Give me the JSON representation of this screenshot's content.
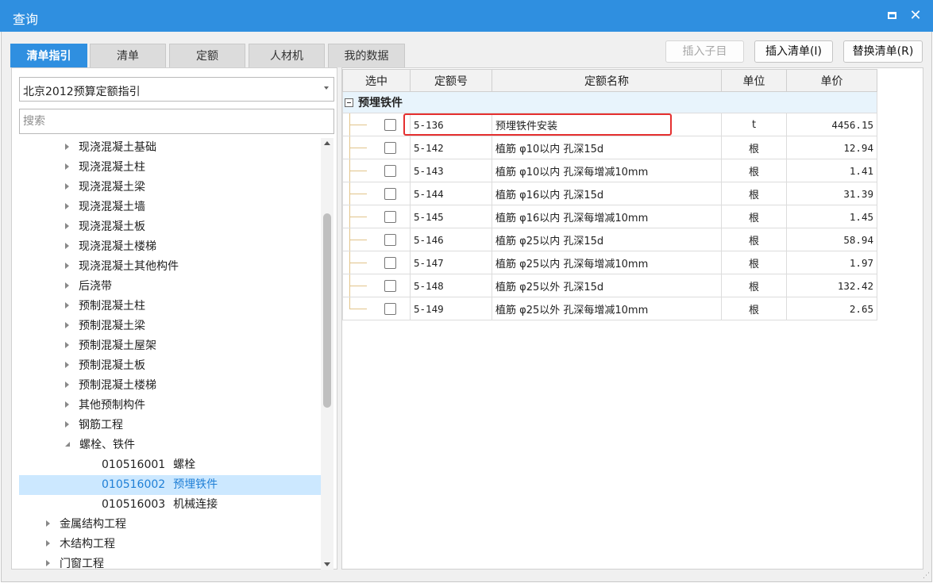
{
  "window": {
    "title": "查询"
  },
  "tabs": [
    "清单指引",
    "清单",
    "定额",
    "人材机",
    "我的数据"
  ],
  "toolbar": {
    "insert_child": "插入子目",
    "insert_list": "插入清单(I)",
    "replace_list": "替换清单(R)"
  },
  "left": {
    "combo_value": "北京2012预算定额指引",
    "search_placeholder": "搜索",
    "tree": [
      {
        "label": "现浇混凝土基础"
      },
      {
        "label": "现浇混凝土柱"
      },
      {
        "label": "现浇混凝土梁"
      },
      {
        "label": "现浇混凝土墙"
      },
      {
        "label": "现浇混凝土板"
      },
      {
        "label": "现浇混凝土楼梯"
      },
      {
        "label": "现浇混凝土其他构件"
      },
      {
        "label": "后浇带"
      },
      {
        "label": "预制混凝土柱"
      },
      {
        "label": "预制混凝土梁"
      },
      {
        "label": "预制混凝土屋架"
      },
      {
        "label": "预制混凝土板"
      },
      {
        "label": "预制混凝土楼梯"
      },
      {
        "label": "其他预制构件"
      },
      {
        "label": "钢筋工程"
      },
      {
        "label": "螺栓、铁件"
      },
      {
        "code": "010516001",
        "label": "螺栓"
      },
      {
        "code": "010516002",
        "label": "预埋铁件"
      },
      {
        "code": "010516003",
        "label": "机械连接"
      },
      {
        "label": "金属结构工程"
      },
      {
        "label": "木结构工程"
      },
      {
        "label": "门窗工程"
      }
    ]
  },
  "grid": {
    "headers": [
      "选中",
      "定额号",
      "定额名称",
      "单位",
      "单价"
    ],
    "group_label": "预埋铁件",
    "rows": [
      {
        "code": "5-136",
        "name": "预埋铁件安装",
        "unit": "t",
        "price": "4456.15"
      },
      {
        "code": "5-142",
        "name": "植筋 φ10以内 孔深15d",
        "unit": "根",
        "price": "12.94"
      },
      {
        "code": "5-143",
        "name": "植筋 φ10以内 孔深每增减10mm",
        "unit": "根",
        "price": "1.41"
      },
      {
        "code": "5-144",
        "name": "植筋 φ16以内 孔深15d",
        "unit": "根",
        "price": "31.39"
      },
      {
        "code": "5-145",
        "name": "植筋 φ16以内 孔深每增减10mm",
        "unit": "根",
        "price": "1.45"
      },
      {
        "code": "5-146",
        "name": "植筋 φ25以内 孔深15d",
        "unit": "根",
        "price": "58.94"
      },
      {
        "code": "5-147",
        "name": "植筋 φ25以内 孔深每增减10mm",
        "unit": "根",
        "price": "1.97"
      },
      {
        "code": "5-148",
        "name": "植筋 φ25以外 孔深15d",
        "unit": "根",
        "price": "132.42"
      },
      {
        "code": "5-149",
        "name": "植筋 φ25以外 孔深每增减10mm",
        "unit": "根",
        "price": "2.65"
      }
    ]
  },
  "colors": {
    "accent": "#2f8fe0",
    "selection": "#cce8ff",
    "highlight_border": "#e53030"
  }
}
